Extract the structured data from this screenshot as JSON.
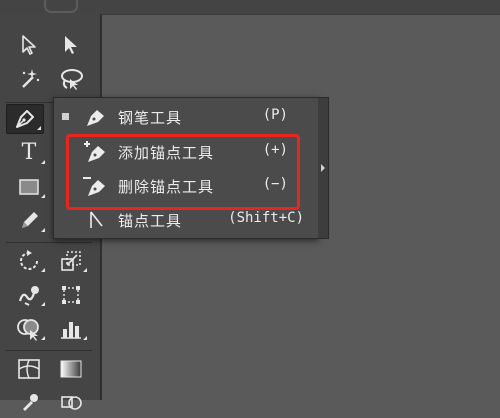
{
  "colors": {
    "workspace": "#5a5a5a",
    "toolbar": "#454545",
    "flyout": "#4b4b4b",
    "highlight": "#e8261e",
    "text": "#ececec"
  },
  "toolbar": {
    "tools": [
      {
        "name": "selection-tool",
        "icon": "arrow-outline-icon"
      },
      {
        "name": "direct-selection-tool",
        "icon": "arrow-solid-icon"
      },
      {
        "name": "magic-wand-tool",
        "icon": "magic-wand-icon"
      },
      {
        "name": "lasso-tool",
        "icon": "lasso-icon"
      },
      {
        "name": "pen-tool",
        "icon": "pen-icon",
        "active": true
      },
      {
        "name": "type-tool",
        "icon": "type-icon",
        "label": "T"
      },
      {
        "name": "line-tool",
        "icon": "line-icon"
      },
      {
        "name": "rectangle-tool",
        "icon": "rectangle-icon"
      },
      {
        "name": "pencil-tool",
        "icon": "pencil-icon"
      },
      {
        "name": "rotate-tool",
        "icon": "rotate-icon"
      },
      {
        "name": "scale-tool",
        "icon": "scale-icon"
      },
      {
        "name": "warp-tool",
        "icon": "warp-icon"
      },
      {
        "name": "free-transform-tool",
        "icon": "free-transform-icon"
      },
      {
        "name": "shape-builder-tool",
        "icon": "shape-builder-icon"
      },
      {
        "name": "graph-tool",
        "icon": "graph-icon"
      },
      {
        "name": "mesh-tool",
        "icon": "mesh-icon"
      },
      {
        "name": "gradient-tool",
        "icon": "gradient-icon"
      }
    ]
  },
  "flyout": {
    "items": [
      {
        "label": "钢笔工具",
        "shortcut": "(P)",
        "icon": "pen-icon",
        "selected": true
      },
      {
        "label": "添加锚点工具",
        "shortcut": "(+)",
        "icon": "add-anchor-point-icon"
      },
      {
        "label": "删除锚点工具",
        "shortcut": "(−)",
        "icon": "delete-anchor-point-icon"
      },
      {
        "label": "锚点工具",
        "shortcut": "(Shift+C)",
        "icon": "anchor-point-icon"
      }
    ]
  }
}
